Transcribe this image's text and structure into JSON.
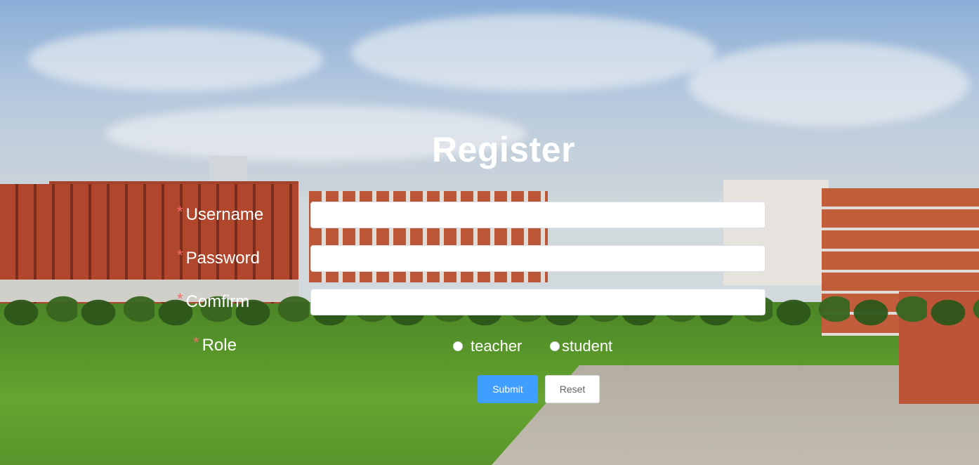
{
  "form": {
    "title": "Register",
    "required_marker": "*",
    "fields": {
      "username": {
        "label": "Username",
        "value": ""
      },
      "password": {
        "label": "Password",
        "value": ""
      },
      "confirm": {
        "label": "Comfirm",
        "value": ""
      }
    },
    "role": {
      "label": "Role",
      "options": [
        "teacher",
        "student"
      ],
      "selected": ""
    },
    "buttons": {
      "submit_label": "Submit",
      "reset_label": "Reset"
    }
  },
  "colors": {
    "primary": "#409eff",
    "required": "#f56c6c",
    "label_text": "#ffffff"
  }
}
